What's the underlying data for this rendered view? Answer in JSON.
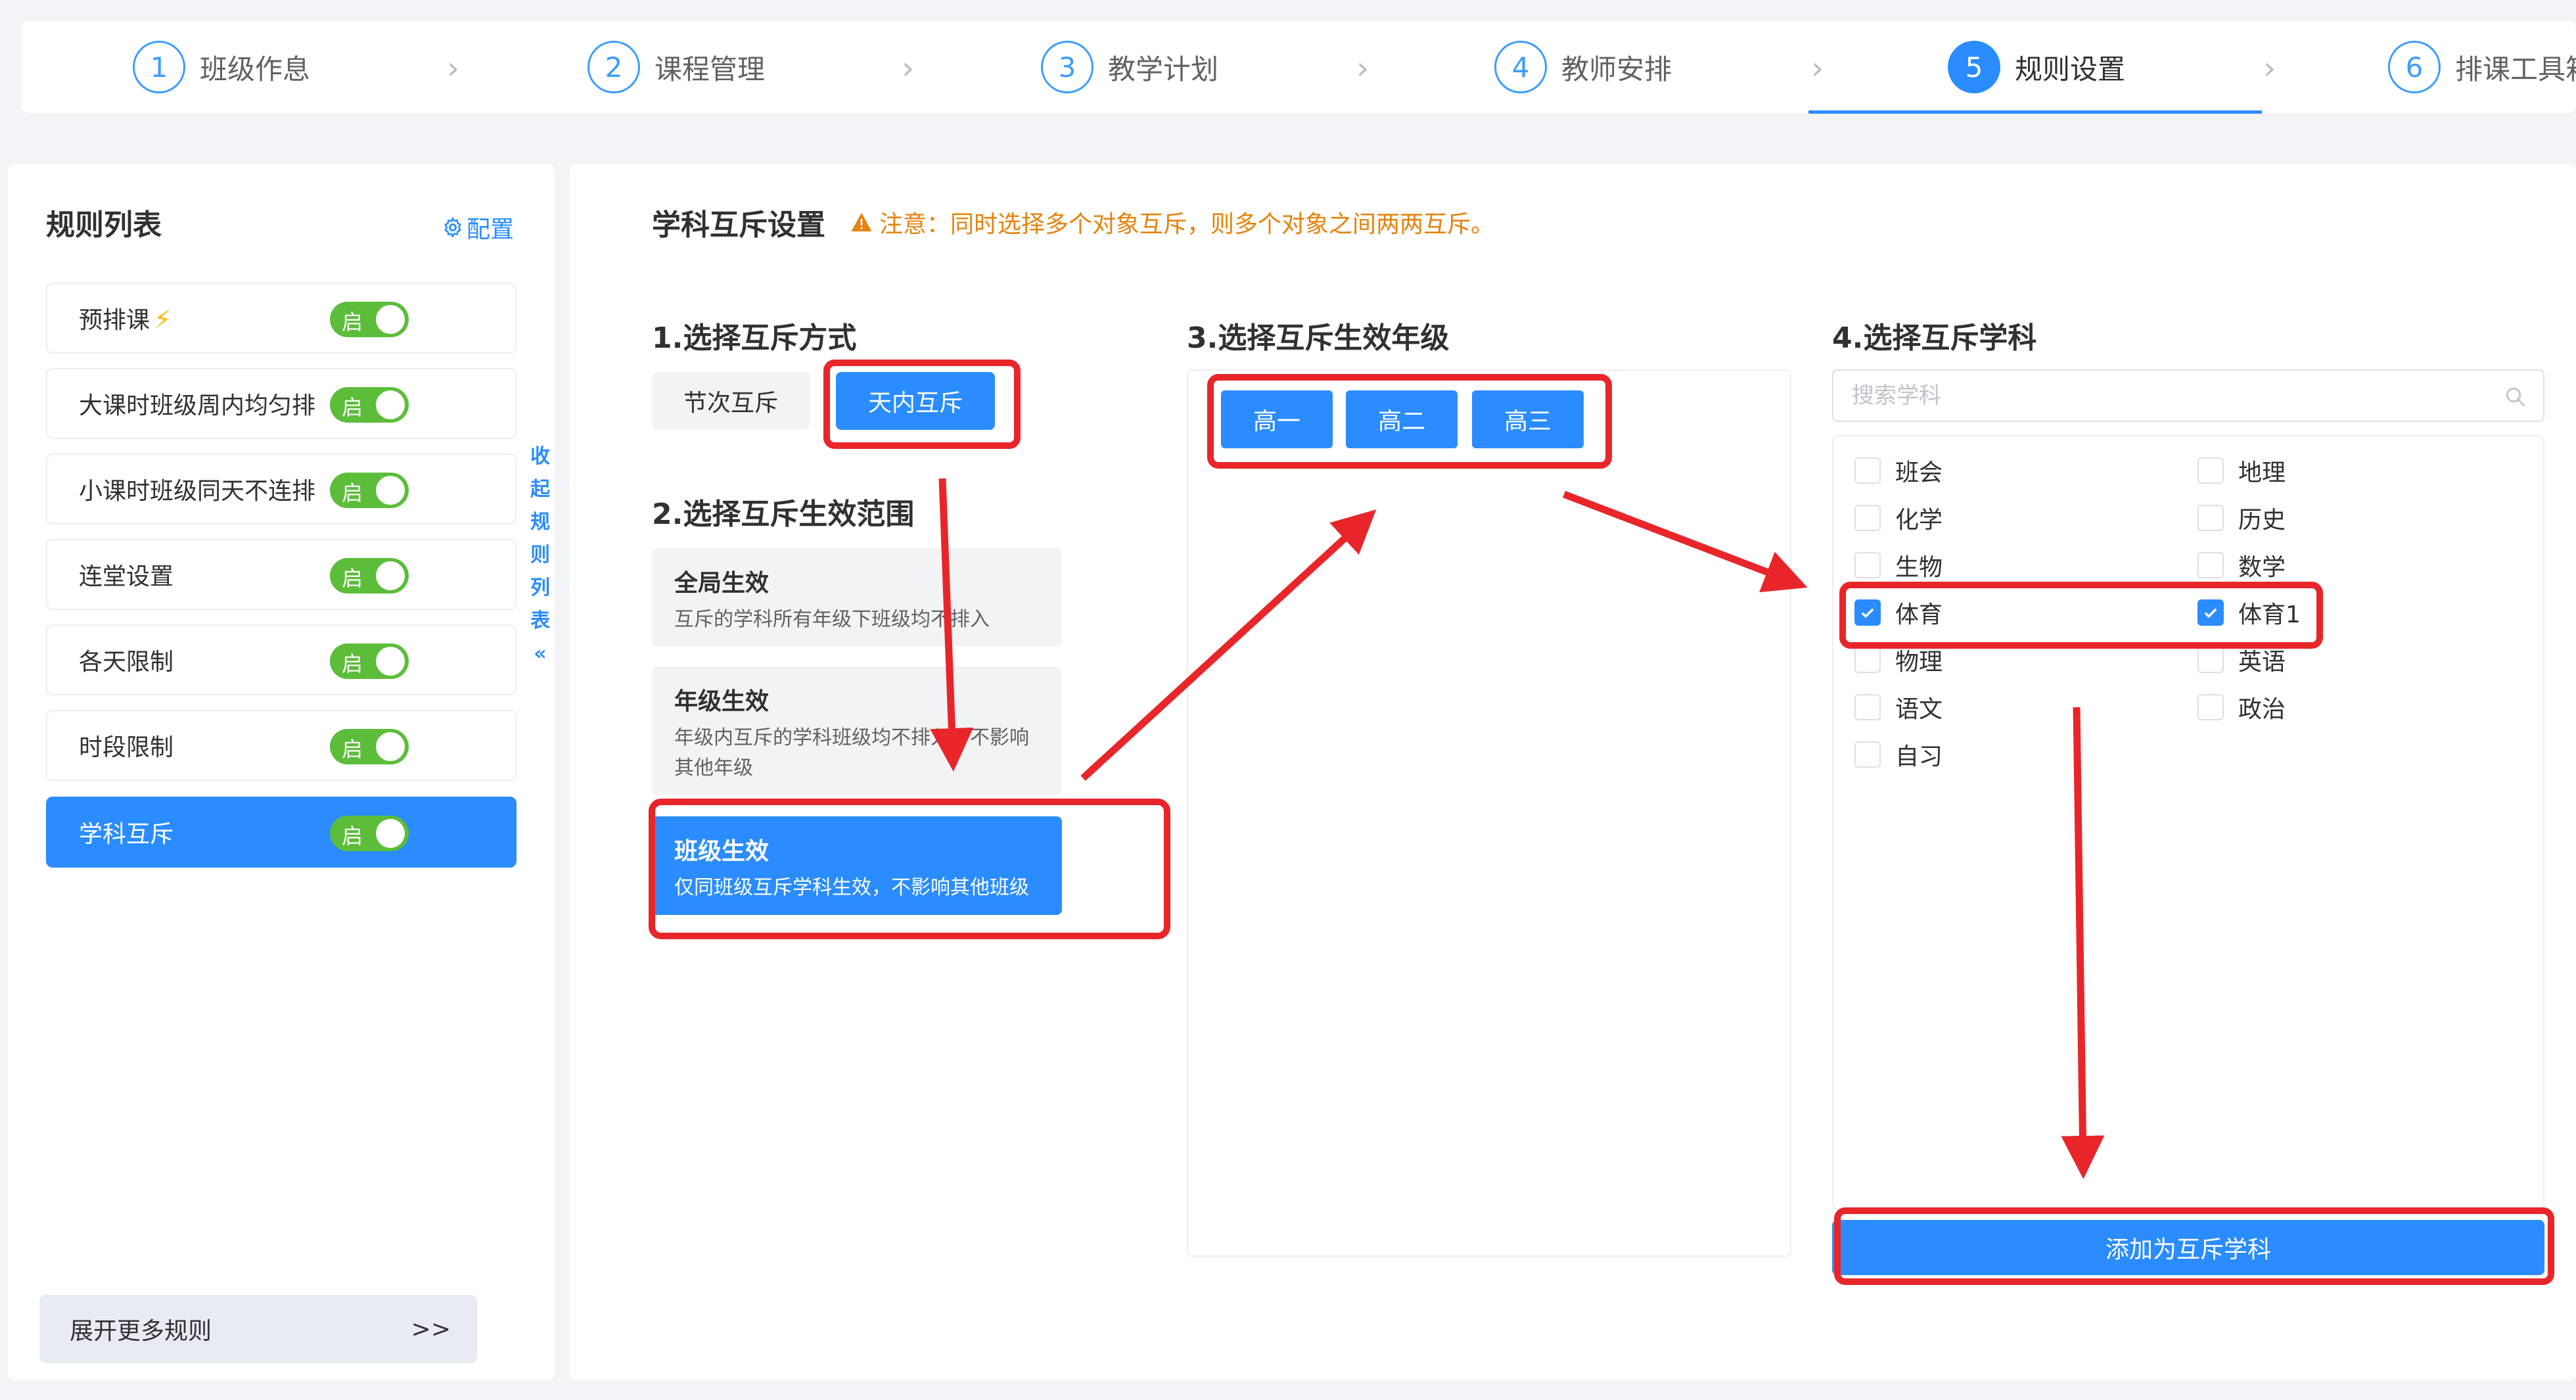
{
  "steps": [
    {
      "num": "1",
      "label": "班级作息"
    },
    {
      "num": "2",
      "label": "课程管理"
    },
    {
      "num": "3",
      "label": "教学计划"
    },
    {
      "num": "4",
      "label": "教师安排"
    },
    {
      "num": "5",
      "label": "规则设置",
      "active": true
    },
    {
      "num": "6",
      "label": "排课工具箱"
    }
  ],
  "sidebar": {
    "title": "规则列表",
    "config_label": "配置",
    "collapse_label": [
      "收",
      "起",
      "规",
      "则",
      "列",
      "表"
    ],
    "toggle_text": "启",
    "rules": [
      {
        "label": "预排课",
        "flash": "⚡"
      },
      {
        "label": "大课时班级周内均匀排"
      },
      {
        "label": "小课时班级同天不连排"
      },
      {
        "label": "连堂设置"
      },
      {
        "label": "各天限制"
      },
      {
        "label": "时段限制"
      },
      {
        "label": "学科互斥",
        "active": true
      }
    ],
    "more_label": "展开更多规则",
    "more_arrow": ">>"
  },
  "main": {
    "title": "学科互斥设置",
    "warning": "注意：同时选择多个对象互斥，则多个对象之间两两互斥。",
    "section1": "1.选择互斥方式",
    "modes": [
      "节次互斥",
      "天内互斥"
    ],
    "section2": "2.选择互斥生效范围",
    "scopes": [
      {
        "title": "全局生效",
        "desc": "互斥的学科所有年级下班级均不排入"
      },
      {
        "title": "年级生效",
        "desc": "年级内互斥的学科班级均不排入，不影响其他年级"
      },
      {
        "title": "班级生效",
        "desc": "仅同班级互斥学科生效，不影响其他班级"
      }
    ],
    "section3": "3.选择互斥生效年级",
    "grades": [
      "高一",
      "高二",
      "高三"
    ],
    "section4": "4.选择互斥学科",
    "search_placeholder": "搜索学科",
    "subjects_left": [
      {
        "name": "班会",
        "checked": false
      },
      {
        "name": "化学",
        "checked": false
      },
      {
        "name": "生物",
        "checked": false
      },
      {
        "name": "体育",
        "checked": true
      },
      {
        "name": "物理",
        "checked": false
      },
      {
        "name": "语文",
        "checked": false
      },
      {
        "name": "自习",
        "checked": false
      }
    ],
    "subjects_right": [
      {
        "name": "地理",
        "checked": false
      },
      {
        "name": "历史",
        "checked": false
      },
      {
        "name": "数学",
        "checked": false
      },
      {
        "name": "体育1",
        "checked": true
      },
      {
        "name": "英语",
        "checked": false
      },
      {
        "name": "政治",
        "checked": false
      }
    ],
    "add_button": "添加为互斥学科"
  },
  "colors": {
    "primary": "#2a8cff",
    "toggle_on": "#5cbd3a",
    "warning": "#e6820e",
    "annotation_red": "#e8262a"
  }
}
